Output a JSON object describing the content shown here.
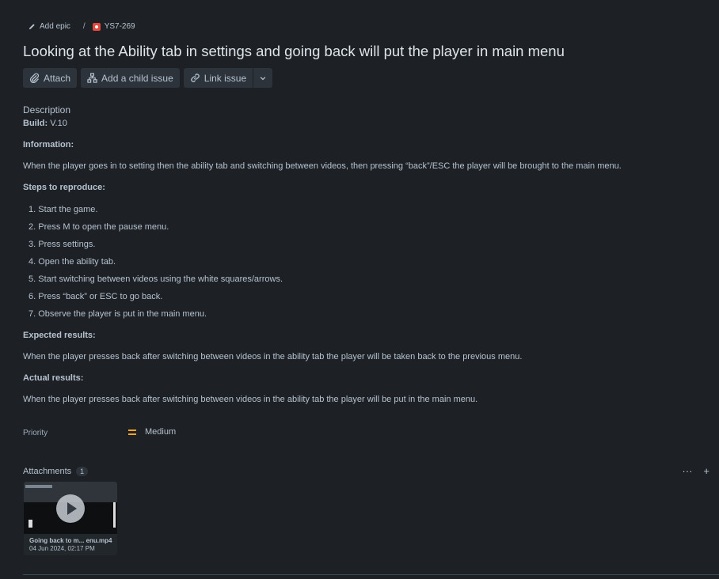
{
  "breadcrumb": {
    "add_epic": "Add epic",
    "separator": "/",
    "issue_key": "YS7-269"
  },
  "issue": {
    "title": "Looking at the Ability tab in settings and going back will put the player in main menu"
  },
  "toolbar": {
    "attach": "Attach",
    "add_child": "Add a child issue",
    "link_issue": "Link issue"
  },
  "description": {
    "heading": "Description",
    "build_label": "Build:",
    "build_value": "V.10",
    "information_heading": "Information:",
    "information_text": "When the player goes in to setting then the ability tab and switching between videos, then pressing “back”/ESC the player will be brought to the main menu.",
    "steps_heading": "Steps to reproduce:",
    "steps": [
      "1. Start the game.",
      "2. Press M to open the pause menu.",
      "3. Press settings.",
      "4. Open the ability tab.",
      "5. Start switching between videos using the white squares/arrows.",
      "6. Press “back” or ESC to go back.",
      "7. Observe the player is put in the main menu."
    ],
    "expected_heading": "Expected results:",
    "expected_text": "When the player presses back after switching between videos in the ability tab the player will be taken back to the previous menu.",
    "actual_heading": "Actual results:",
    "actual_text": "When the player presses back after switching between videos in the ability tab the player will be put in the main menu."
  },
  "priority": {
    "label": "Priority",
    "value": "Medium",
    "color": "#f5a623"
  },
  "attachments": {
    "heading": "Attachments",
    "count": "1",
    "more": "···",
    "add": "+",
    "items": [
      {
        "name": "Going back to m... enu.mp4",
        "date": "04 Jun 2024, 02:17 PM"
      }
    ]
  }
}
